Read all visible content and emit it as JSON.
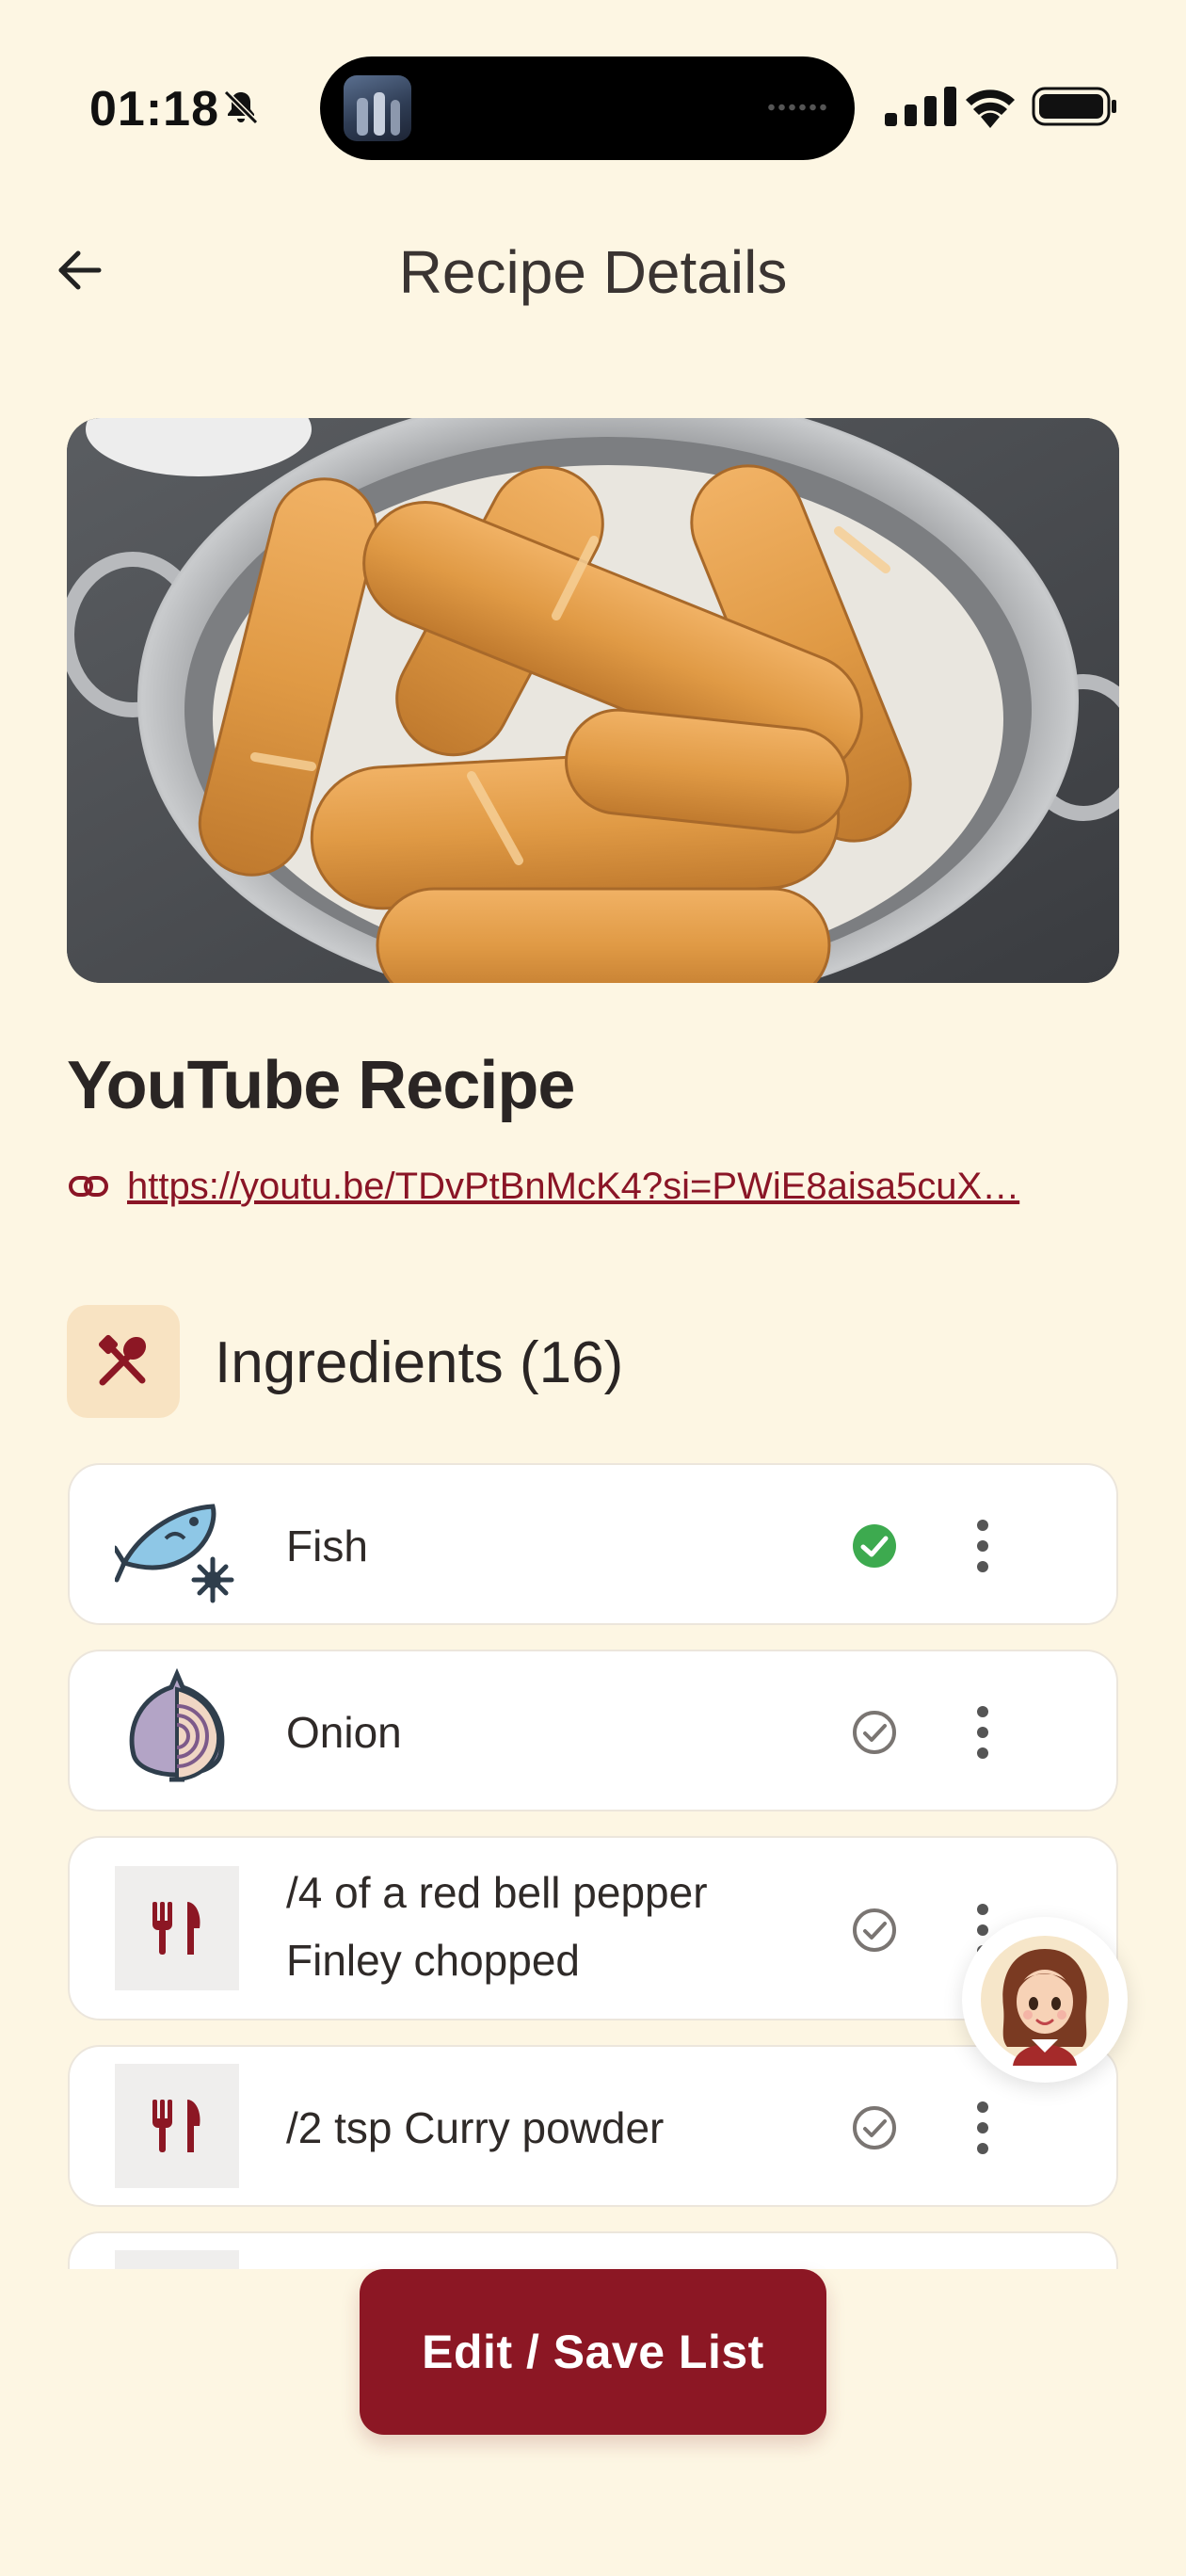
{
  "status_bar": {
    "time": "01:18",
    "icons": [
      "bell-slash-icon",
      "signal-icon",
      "wifi-icon",
      "battery-icon"
    ]
  },
  "header": {
    "title": "Recipe Details",
    "back_icon": "arrow-left-icon"
  },
  "recipe": {
    "title": "YouTube Recipe",
    "link": "https://youtu.be/TDvPtBnMcK4?si=PWiE8aisa5cuX…",
    "link_icon": "link-icon"
  },
  "ingredients": {
    "heading": "Ingredients (16)",
    "icon": "utensils-icon",
    "items": [
      {
        "name": "Fish",
        "icon": "frozen-fish-icon",
        "checked": true
      },
      {
        "name": "Onion",
        "icon": "onion-icon",
        "checked": false
      },
      {
        "name": "/4 of a red bell pepper Finley chopped",
        "icon": "utensils-icon",
        "checked": false
      },
      {
        "name": "/2 tsp Curry powder",
        "icon": "utensils-icon",
        "checked": false
      }
    ]
  },
  "assistant": {
    "icon": "chef-avatar-icon"
  },
  "actions": {
    "edit_save": "Edit / Save List"
  },
  "colors": {
    "background": "#FDF6E3",
    "primary": "#8C1724",
    "badge_bg": "#F8E3C2",
    "check_done": "#3DAA4F",
    "check_idle": "#7a7572"
  }
}
